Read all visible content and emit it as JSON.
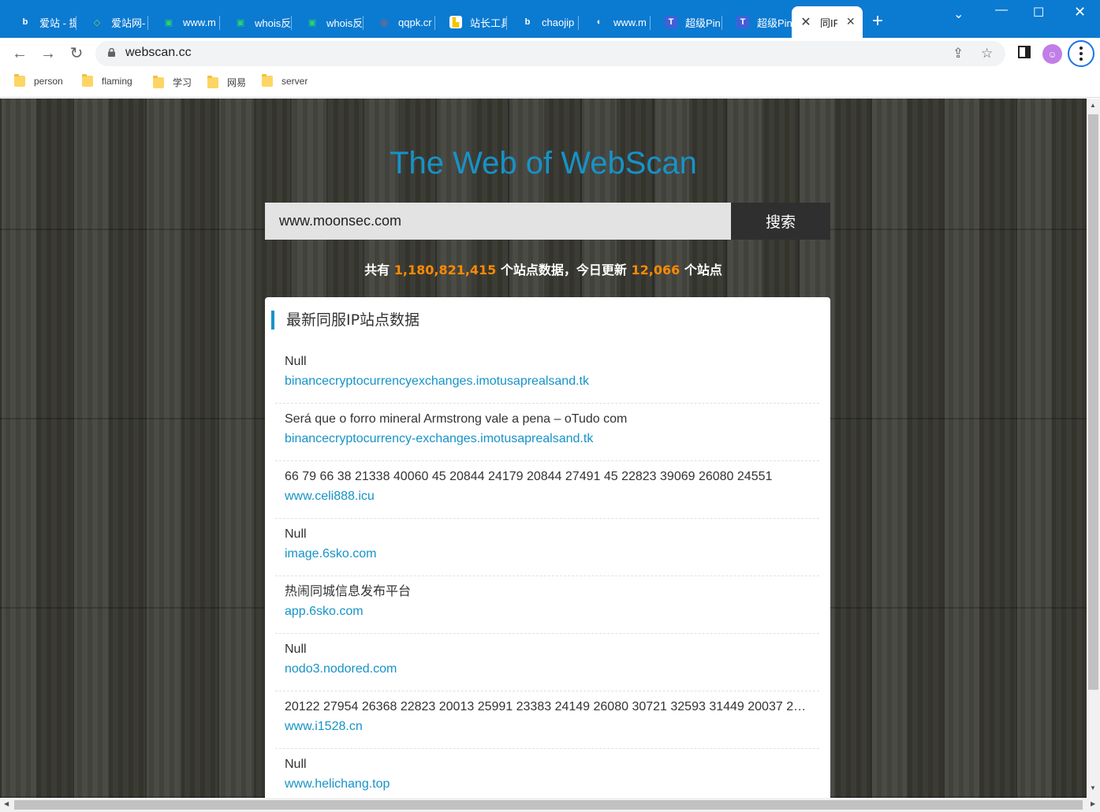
{
  "browser": {
    "tabs": [
      {
        "title": "爱站 - 提",
        "icon": "bing-icon",
        "icon_color": "#ffffff",
        "icon_glyph": "b"
      },
      {
        "title": "爱站网-",
        "icon": "aizhan-diamond-icon",
        "icon_color": "#7ed957",
        "icon_glyph": "◇"
      },
      {
        "title": "www.m",
        "icon": "chinaz-icon",
        "icon_color": "#2bd469",
        "icon_glyph": "▣"
      },
      {
        "title": "whois反",
        "icon": "chinaz-icon",
        "icon_color": "#2bd469",
        "icon_glyph": "▣"
      },
      {
        "title": "whois反",
        "icon": "chinaz-icon",
        "icon_color": "#2bd469",
        "icon_glyph": "▣"
      },
      {
        "title": "qqpk.cr",
        "icon": "qqpk-icon",
        "icon_color": "#e8553c",
        "icon_glyph": "◎"
      },
      {
        "title": "站长工具",
        "icon": "zhanzhang-icon",
        "icon_color": "#f5c400",
        "icon_glyph": "▙"
      },
      {
        "title": "chaojip",
        "icon": "bing-icon",
        "icon_color": "#ffffff",
        "icon_glyph": "b"
      },
      {
        "title": "www.m",
        "icon": "moon-icon",
        "icon_color": "#ffffff",
        "icon_glyph": "◐"
      },
      {
        "title": "超级Pin",
        "icon": "tool-t-icon",
        "icon_color": "#4060d8",
        "icon_glyph": "T"
      },
      {
        "title": "超级Pin",
        "icon": "tool-t-icon",
        "icon_color": "#4060d8",
        "icon_glyph": "T"
      },
      {
        "title": "同IP",
        "icon": "tools-cross-icon",
        "icon_color": "#3c4043",
        "icon_glyph": "✕"
      }
    ],
    "url": "webscan.cc",
    "bookmarks": [
      "person",
      "flaming",
      "学习",
      "网易",
      "server"
    ]
  },
  "page": {
    "title": "The Web of WebScan",
    "search": {
      "value": "www.moonsec.com",
      "button": "搜索"
    },
    "stats": {
      "prefix": "共有",
      "total": "1,180,821,415",
      "middle": "个站点数据，今日更新",
      "today": "12,066",
      "suffix": "个站点"
    },
    "panel_title": "最新同服IP站点数据",
    "rows": [
      {
        "title": "Null",
        "link": "binancecryptocurrencyexchanges.imotusaprealsand.tk"
      },
      {
        "title": "Será que o forro mineral Armstrong vale a pena – oTudo com",
        "link": "binancecryptocurrency-exchanges.imotusaprealsand.tk"
      },
      {
        "title": "66 79 66 38 21338 40060 45 20844 24179 20844 27491 45 22823 39069 26080 24551",
        "link": "www.celi888.icu"
      },
      {
        "title": "Null",
        "link": "image.6sko.com"
      },
      {
        "title": "热闹同城信息发布平台",
        "link": "app.6sko.com"
      },
      {
        "title": "Null",
        "link": "nodo3.nodored.com"
      },
      {
        "title": "20122 27954 26368 22823 20013 25991 23383 24149 26080 30721 32593 31449 20037 200…",
        "link": "www.i1528.cn"
      },
      {
        "title": "Null",
        "link": "www.helichang.top"
      }
    ]
  },
  "colors": {
    "accent": "#1693c7",
    "highlight": "#ff8a00",
    "chrome": "#0b7ad1"
  }
}
